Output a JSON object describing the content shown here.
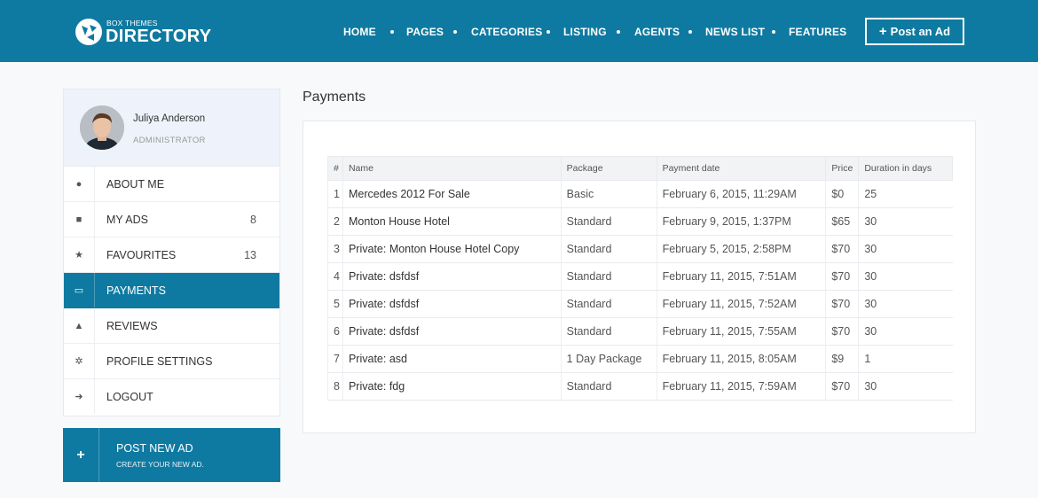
{
  "brand": {
    "small": "BOX THEMES",
    "big": "DIRECTORY"
  },
  "nav": [
    "HOME",
    "PAGES",
    "CATEGORIES",
    "LISTING",
    "AGENTS",
    "NEWS LIST",
    "FEATURES"
  ],
  "header_button": {
    "icon": "+",
    "label": "Post an Ad"
  },
  "profile": {
    "name": "Juliya Anderson",
    "role": "ADMINISTRATOR"
  },
  "menu": [
    {
      "label": "ABOUT ME",
      "count": "",
      "icon": "user-icon",
      "glyph": "●"
    },
    {
      "label": "MY ADS",
      "count": "8",
      "icon": "briefcase-icon",
      "glyph": "■"
    },
    {
      "label": "FAVOURITES",
      "count": "13",
      "icon": "star-icon",
      "glyph": "★"
    },
    {
      "label": "PAYMENTS",
      "count": "",
      "icon": "credit-card-icon",
      "glyph": "▭",
      "active": true
    },
    {
      "label": "REVIEWS",
      "count": "",
      "icon": "thumbs-up-icon",
      "glyph": "▲"
    },
    {
      "label": "PROFILE SETTINGS",
      "count": "",
      "icon": "gear-icon",
      "glyph": "✲"
    },
    {
      "label": "LOGOUT",
      "count": "",
      "icon": "sign-out-icon",
      "glyph": "➜"
    }
  ],
  "post_new": {
    "icon": "+",
    "title": "POST NEW AD",
    "subtitle": "CREATE YOUR NEW AD."
  },
  "main": {
    "title": "Payments",
    "table": {
      "headers": [
        "#",
        "Name",
        "Package",
        "Payment date",
        "Price",
        "Duration in days"
      ],
      "rows": [
        [
          "1",
          "Mercedes 2012 For Sale",
          "Basic",
          "February 6, 2015, 11:29AM",
          "$0",
          "25"
        ],
        [
          "2",
          "Monton House Hotel",
          "Standard",
          "February 9, 2015, 1:37PM",
          "$65",
          "30"
        ],
        [
          "3",
          "Private: Monton House Hotel Copy",
          "Standard",
          "February 5, 2015, 2:58PM",
          "$70",
          "30"
        ],
        [
          "4",
          "Private: dsfdsf",
          "Standard",
          "February 11, 2015, 7:51AM",
          "$70",
          "30"
        ],
        [
          "5",
          "Private: dsfdsf",
          "Standard",
          "February 11, 2015, 7:52AM",
          "$70",
          "30"
        ],
        [
          "6",
          "Private: dsfdsf",
          "Standard",
          "February 11, 2015, 7:55AM",
          "$70",
          "30"
        ],
        [
          "7",
          "Private: asd",
          "1 Day Package",
          "February 11, 2015, 8:05AM",
          "$9",
          "1"
        ],
        [
          "8",
          "Private: fdg",
          "Standard",
          "February 11, 2015, 7:59AM",
          "$70",
          "30"
        ]
      ]
    }
  },
  "colors": {
    "primary": "#0f7aa1",
    "background": "#f8f9fb",
    "profile_bg": "#eef3fb"
  }
}
